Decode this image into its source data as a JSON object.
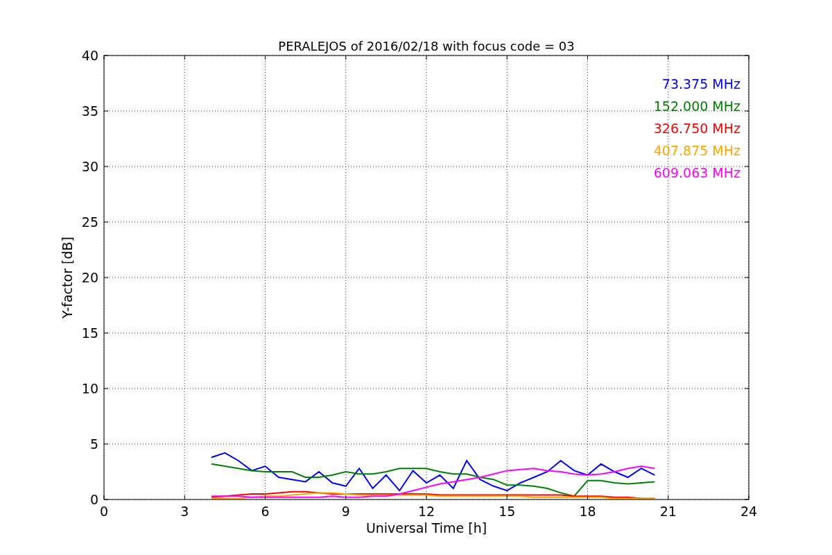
{
  "figure": {
    "chart_data": {
      "type": "line",
      "title": "PERALEJOS of 2016/02/18 with focus code = 03",
      "xlabel": "Universal Time [h]",
      "ylabel": "Y-factor [dB]",
      "grid": true,
      "xlim": [
        0,
        24
      ],
      "ylim": [
        0,
        40
      ],
      "xticks": [
        0,
        3,
        6,
        9,
        12,
        15,
        18,
        21,
        24
      ],
      "yticks": [
        0,
        5,
        10,
        15,
        20,
        25,
        30,
        35,
        40
      ],
      "x": [
        4,
        4.5,
        5,
        5.5,
        6,
        6.5,
        7,
        7.5,
        8,
        8.5,
        9,
        9.5,
        10,
        10.5,
        11,
        11.5,
        12,
        12.5,
        13,
        13.5,
        14,
        14.5,
        15,
        15.5,
        16,
        16.5,
        17,
        17.5,
        18,
        18.5,
        19,
        19.5,
        20,
        20.5
      ],
      "series": [
        {
          "name": "73.375 MHz",
          "color": "#0000ff",
          "values": [
            3.8,
            4.2,
            3.5,
            2.6,
            3.0,
            2.0,
            1.8,
            1.6,
            2.5,
            1.5,
            1.2,
            2.8,
            1.0,
            2.2,
            0.8,
            2.6,
            1.5,
            2.2,
            1.0,
            3.5,
            1.8,
            1.2,
            0.8,
            1.5,
            2.0,
            2.5,
            3.5,
            2.6,
            2.2,
            3.2,
            2.5,
            2.0,
            2.8,
            2.2
          ]
        },
        {
          "name": "152.000 MHz",
          "color": "#008000",
          "values": [
            3.2,
            3.0,
            2.8,
            2.6,
            2.5,
            2.5,
            2.5,
            2.0,
            2.0,
            2.2,
            2.5,
            2.3,
            2.3,
            2.5,
            2.8,
            2.8,
            2.8,
            2.5,
            2.3,
            2.3,
            2.0,
            1.8,
            1.3,
            1.3,
            1.2,
            1.0,
            0.6,
            0.3,
            1.7,
            1.7,
            1.5,
            1.4,
            1.5,
            1.6
          ]
        },
        {
          "name": "326.750 MHz",
          "color": "#ff0000",
          "values": [
            0.2,
            0.3,
            0.4,
            0.5,
            0.5,
            0.6,
            0.7,
            0.7,
            0.6,
            0.5,
            0.5,
            0.5,
            0.5,
            0.5,
            0.5,
            0.5,
            0.5,
            0.4,
            0.4,
            0.4,
            0.4,
            0.4,
            0.4,
            0.4,
            0.4,
            0.4,
            0.4,
            0.3,
            0.3,
            0.3,
            0.2,
            0.2,
            0.1,
            0.1
          ]
        },
        {
          "name": "407.875 MHz",
          "color": "#ffa500",
          "values": [
            0.1,
            0.1,
            0.1,
            0.2,
            0.3,
            0.3,
            0.4,
            0.5,
            0.6,
            0.6,
            0.5,
            0.4,
            0.4,
            0.4,
            0.4,
            0.4,
            0.4,
            0.3,
            0.3,
            0.3,
            0.3,
            0.3,
            0.3,
            0.3,
            0.2,
            0.2,
            0.2,
            0.2,
            0.2,
            0.2,
            0.1,
            0.1,
            0.1,
            0.1
          ]
        },
        {
          "name": "609.063 MHz",
          "color": "#ff00ff",
          "values": [
            0.3,
            0.3,
            0.3,
            0.2,
            0.2,
            0.2,
            0.2,
            0.2,
            0.2,
            0.3,
            0.2,
            0.2,
            0.3,
            0.3,
            0.5,
            0.8,
            1.1,
            1.4,
            1.6,
            1.8,
            2.0,
            2.3,
            2.6,
            2.7,
            2.8,
            2.6,
            2.5,
            2.3,
            2.2,
            2.3,
            2.5,
            2.8,
            3.0,
            2.8
          ]
        }
      ]
    }
  }
}
